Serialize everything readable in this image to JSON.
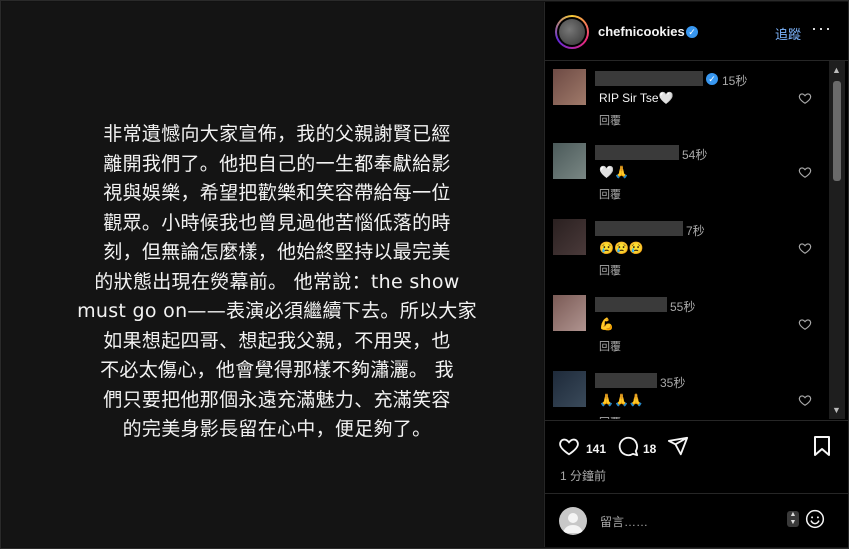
{
  "post": {
    "caption": "非常遺憾向大家宣佈，我的父親謝賢已經\n離開我們了。他把自己的一生都奉獻給影\n視與娛樂，希望把歡樂和笑容帶給每一位\n觀眾。小時候我也曾見過他苦惱低落的時\n刻，但無論怎麼樣，他始終堅持以最完美\n的狀態出現在熒幕前。 他常說：the show\nmust go on——表演必須繼續下去。所以大家\n如果想起四哥、想起我父親，不用哭，也\n不必太傷心，他會覺得那樣不夠瀟灑。 我\n們只要把他那個永遠充滿魅力、充滿笑容\n的完美身影長留在心中，便足夠了。"
  },
  "header": {
    "username": "chefnicookies",
    "verified_icon": "verified-badge-icon",
    "follow_label": "追蹤",
    "more_label": "···"
  },
  "comments": [
    {
      "time": "15秒",
      "text": "RIP Sir Tse🤍",
      "reply": "回覆",
      "verified": true,
      "avatar_colors": [
        "#6d4a44",
        "#a07a6a"
      ]
    },
    {
      "time": "54秒",
      "text": "🤍🙏",
      "reply": "回覆",
      "verified": false,
      "avatar_colors": [
        "#4b5a5a",
        "#7a8784"
      ]
    },
    {
      "time": "7秒",
      "text": "😢😢😢",
      "reply": "回覆",
      "verified": false,
      "avatar_colors": [
        "#2a2020",
        "#4a3a3a"
      ]
    },
    {
      "time": "55秒",
      "text": "💪",
      "reply": "回覆",
      "verified": false,
      "avatar_colors": [
        "#7a5a55",
        "#b09490"
      ]
    },
    {
      "time": "35秒",
      "text": "🙏🙏🙏",
      "reply": "回覆",
      "verified": false,
      "avatar_colors": [
        "#1e2a3a",
        "#3a4a5a"
      ]
    }
  ],
  "actions": {
    "likes": "141",
    "comments": "18",
    "time_ago": "1 分鐘前"
  },
  "composer": {
    "placeholder": "留言……"
  }
}
